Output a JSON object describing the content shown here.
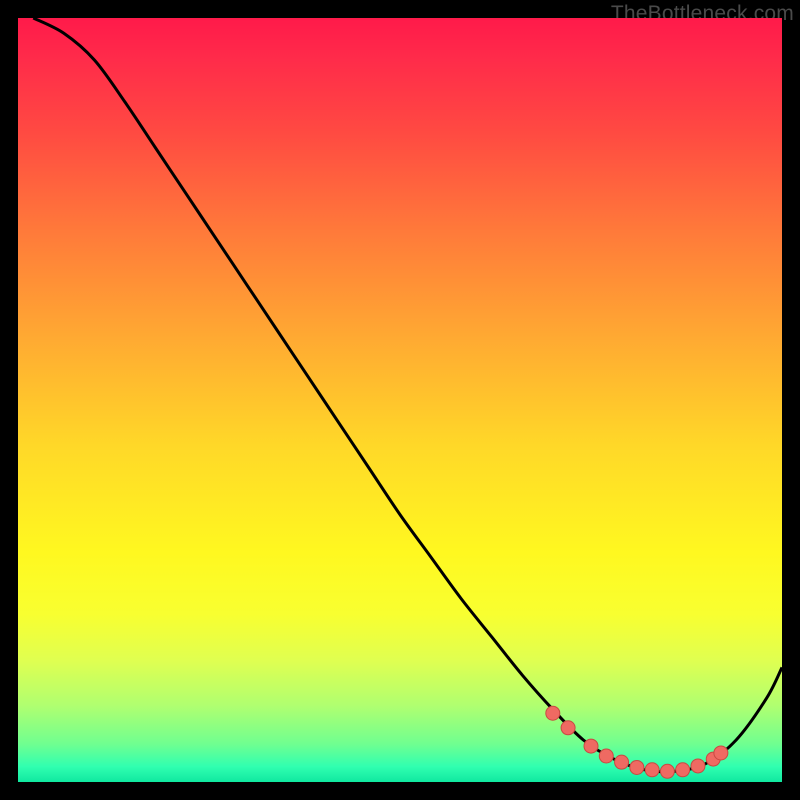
{
  "watermark": "TheBottleneck.com",
  "chart_data": {
    "type": "line",
    "title": "",
    "xlabel": "",
    "ylabel": "",
    "xlim": [
      0,
      100
    ],
    "ylim": [
      0,
      100
    ],
    "grid": false,
    "legend": false,
    "series": [
      {
        "name": "bottleneck-curve",
        "x": [
          2,
          6,
          10,
          14,
          18,
          22,
          26,
          30,
          34,
          38,
          42,
          46,
          50,
          54,
          58,
          62,
          66,
          70,
          74,
          78,
          82,
          86,
          90,
          94,
          98,
          100
        ],
        "y": [
          100,
          98,
          94.5,
          89,
          83,
          77,
          71,
          65,
          59,
          53,
          47,
          41,
          35,
          29.5,
          24,
          19,
          14,
          9.5,
          5.5,
          3,
          1.6,
          1.4,
          2.4,
          5.5,
          11,
          15
        ]
      }
    ],
    "markers": {
      "x": [
        70,
        72,
        75,
        77,
        79,
        81,
        83,
        85,
        87,
        89,
        91,
        92
      ],
      "y": [
        9.0,
        7.1,
        4.7,
        3.4,
        2.6,
        1.9,
        1.6,
        1.4,
        1.6,
        2.1,
        3.0,
        3.8
      ]
    },
    "background_gradient": {
      "top": "#ff1a4a",
      "middle": "#fff820",
      "bottom": "#10e8a0"
    }
  }
}
